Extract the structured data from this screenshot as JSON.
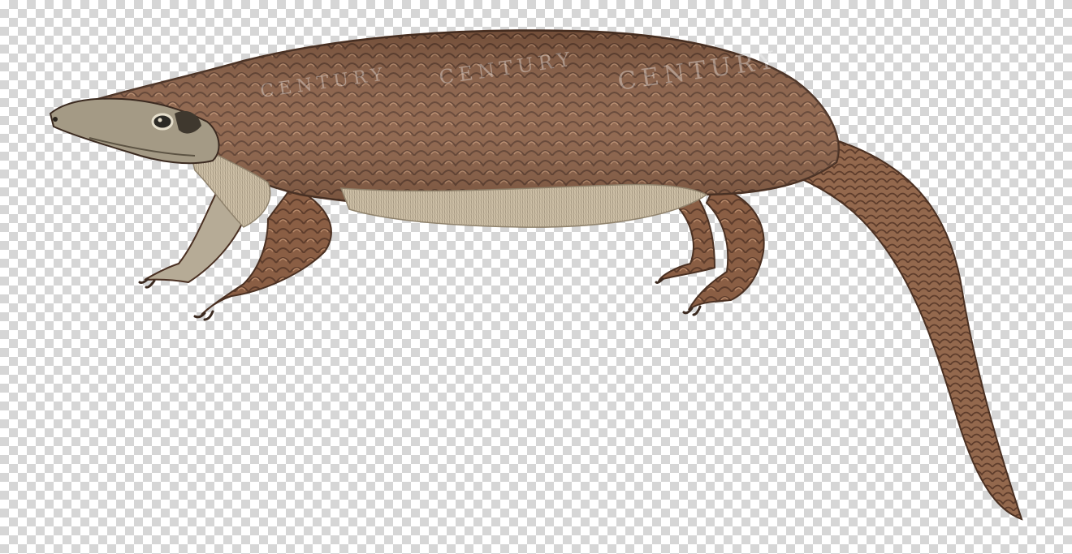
{
  "image": {
    "subject": "pangolin-illustration",
    "background": "transparency-checkerboard",
    "colors": {
      "scales_base": "#8a5e44",
      "scales_light": "#b98a6a",
      "scales_dark": "#5e3d2c",
      "belly": "#cdbfa6",
      "face": "#a49a85",
      "claws": "#3b2a20",
      "checker_light": "#ffffff",
      "checker_dark": "#d6d6d6"
    },
    "watermark": {
      "text_main": "CENTURY",
      "text_secondary": "CENTURY",
      "text_tertiary": "CENTURY"
    }
  }
}
